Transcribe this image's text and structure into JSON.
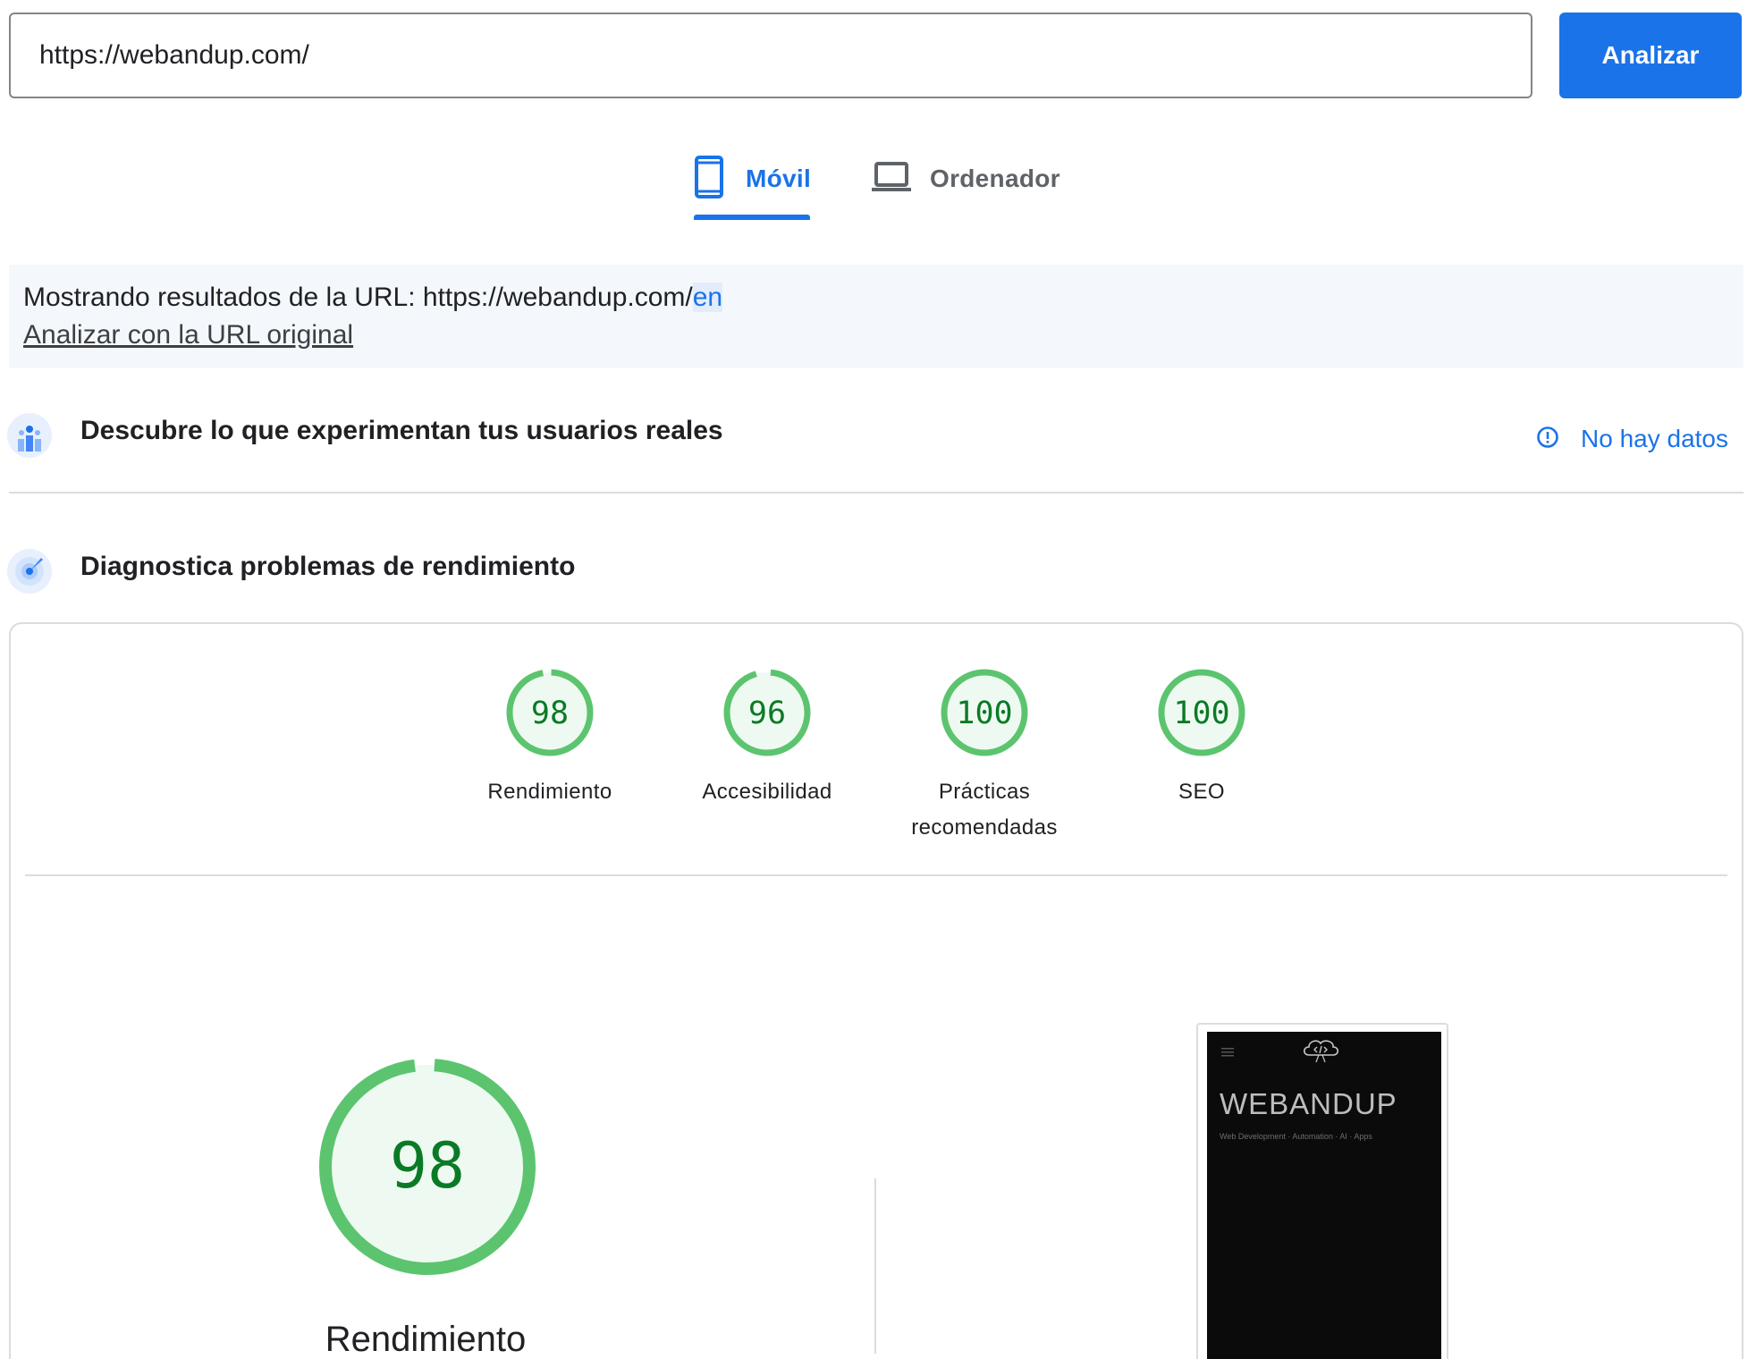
{
  "search": {
    "url_value": "https://webandup.com/",
    "button_label": "Analizar"
  },
  "tabs": [
    {
      "label": "Móvil",
      "icon": "phone-icon",
      "active": true
    },
    {
      "label": "Ordenador",
      "icon": "laptop-icon",
      "active": false
    }
  ],
  "notice": {
    "prefix": "Mostrando resultados de la URL: https://webandup.com/",
    "highlight": "en",
    "link": "Analizar con la URL original"
  },
  "field_data": {
    "title": "Descubre lo que experimentan tus usuarios reales",
    "icon": "users-chart-icon",
    "status": "No hay datos",
    "status_icon": "info-icon"
  },
  "lab": {
    "title": "Diagnostica problemas de rendimiento",
    "icon": "radar-icon"
  },
  "scores": [
    {
      "value": "98",
      "label": "Rendimiento"
    },
    {
      "value": "96",
      "label": "Accesibilidad"
    },
    {
      "value": "100",
      "label": "Prácticas recomendadas"
    },
    {
      "value": "100",
      "label": "SEO"
    }
  ],
  "main_score": {
    "value": "98",
    "label": "Rendimiento"
  },
  "screenshot": {
    "site_title": "WEBANDUP",
    "site_subtitle": "Web Development · Automation · AI · Apps"
  },
  "colors": {
    "accent": "#1a73e8",
    "pass": "#0cce6b",
    "pass_text": "#0b7a26",
    "pass_bg": "#eefaf1"
  }
}
